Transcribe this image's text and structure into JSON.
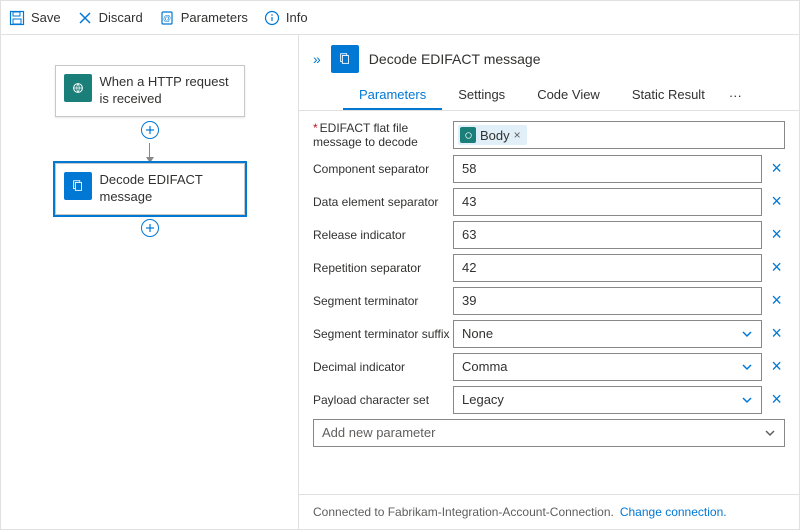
{
  "toolbar": {
    "save": "Save",
    "discard": "Discard",
    "parameters": "Parameters",
    "info": "Info"
  },
  "canvas": {
    "node1": "When a HTTP request is received",
    "node2": "Decode EDIFACT message"
  },
  "panel": {
    "title": "Decode EDIFACT message",
    "tabs": {
      "parameters": "Parameters",
      "settings": "Settings",
      "codeview": "Code View",
      "static": "Static Result",
      "more": "···"
    },
    "fields": {
      "flatfile_label": "EDIFACT flat file message to decode",
      "flatfile_token": "Body",
      "component_label": "Component separator",
      "component_value": "58",
      "dataelem_label": "Data element separator",
      "dataelem_value": "43",
      "release_label": "Release indicator",
      "release_value": "63",
      "repetition_label": "Repetition separator",
      "repetition_value": "42",
      "segterm_label": "Segment terminator",
      "segterm_value": "39",
      "segsuffix_label": "Segment terminator suffix",
      "segsuffix_value": "None",
      "decimal_label": "Decimal indicator",
      "decimal_value": "Comma",
      "charset_label": "Payload character set",
      "charset_value": "Legacy",
      "addparam": "Add new parameter"
    },
    "footer": {
      "connected": "Connected to Fabrikam-Integration-Account-Connection.",
      "change": "Change connection."
    }
  }
}
